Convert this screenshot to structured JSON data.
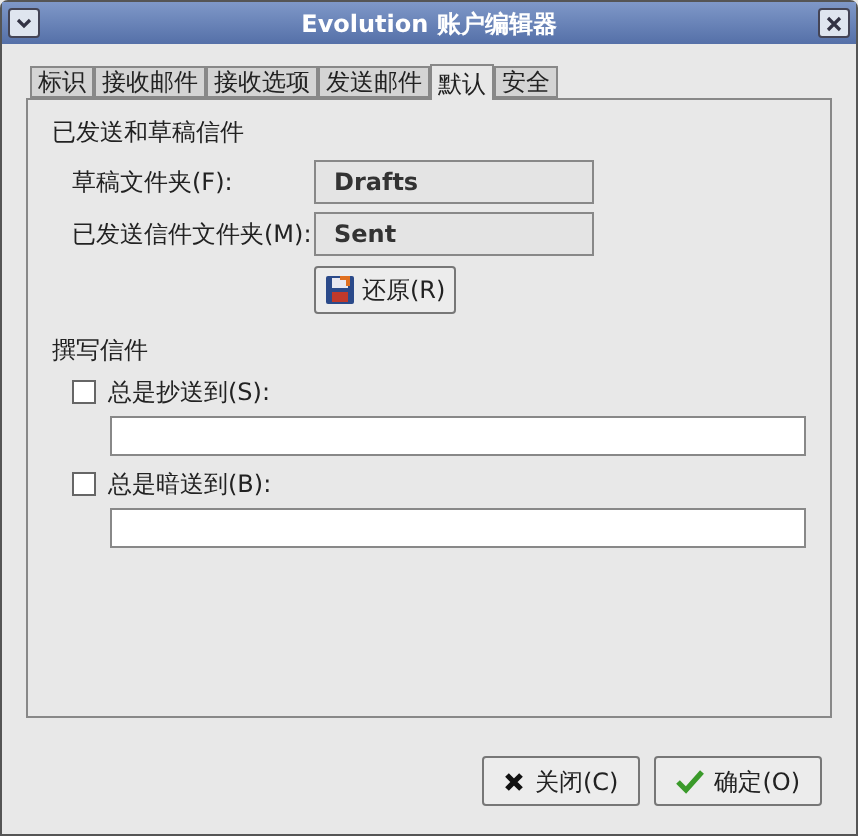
{
  "window": {
    "title": "Evolution 账户编辑器"
  },
  "tabs": [
    {
      "label": "标识",
      "selected": false
    },
    {
      "label": "接收邮件",
      "selected": false
    },
    {
      "label": "接收选项",
      "selected": false
    },
    {
      "label": "发送邮件",
      "selected": false
    },
    {
      "label": "默认",
      "selected": true
    },
    {
      "label": "安全",
      "selected": false
    }
  ],
  "sent_and_drafts": {
    "title": "已发送和草稿信件",
    "folders": [
      {
        "label": "草稿文件夹(F):",
        "value": "Drafts"
      },
      {
        "label": "已发送信件文件夹(M):",
        "value": "Sent"
      }
    ],
    "revert_button": "还原(R)"
  },
  "composing": {
    "title": "撰写信件",
    "options": [
      {
        "label": "总是抄送到(S):",
        "checked": false
      },
      {
        "label": "总是暗送到(B):",
        "checked": false
      }
    ]
  },
  "buttons": [
    {
      "kind": "close",
      "label": "关闭(C)"
    },
    {
      "kind": "ok",
      "label": "确定(O)"
    }
  ]
}
